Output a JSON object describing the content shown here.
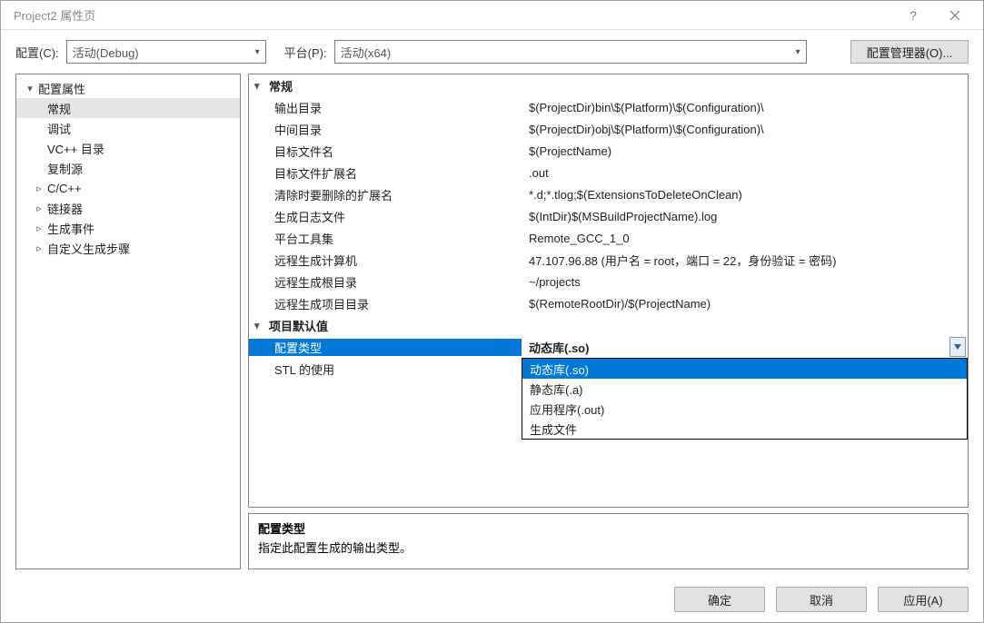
{
  "window": {
    "title": "Project2 属性页"
  },
  "toolbar": {
    "config_label": "配置(C):",
    "config_value": "活动(Debug)",
    "platform_label": "平台(P):",
    "platform_value": "活动(x64)",
    "config_mgr": "配置管理器(O)..."
  },
  "tree": {
    "root": "配置属性",
    "items": [
      {
        "label": "常规",
        "selected": true
      },
      {
        "label": "调试"
      },
      {
        "label": "VC++ 目录"
      },
      {
        "label": "复制源"
      },
      {
        "label": "C/C++",
        "expandable": true
      },
      {
        "label": "链接器",
        "expandable": true
      },
      {
        "label": "生成事件",
        "expandable": true
      },
      {
        "label": "自定义生成步骤",
        "expandable": true
      }
    ]
  },
  "categories": [
    {
      "name": "常规",
      "props": [
        {
          "name": "输出目录",
          "value": "$(ProjectDir)bin\\$(Platform)\\$(Configuration)\\"
        },
        {
          "name": "中间目录",
          "value": "$(ProjectDir)obj\\$(Platform)\\$(Configuration)\\"
        },
        {
          "name": "目标文件名",
          "value": "$(ProjectName)"
        },
        {
          "name": "目标文件扩展名",
          "value": ".out"
        },
        {
          "name": "清除时要删除的扩展名",
          "value": "*.d;*.tlog;$(ExtensionsToDeleteOnClean)"
        },
        {
          "name": "生成日志文件",
          "value": "$(IntDir)$(MSBuildProjectName).log"
        },
        {
          "name": "平台工具集",
          "value": "Remote_GCC_1_0"
        },
        {
          "name": "远程生成计算机",
          "value": "47.107.96.88 (用户名 = root，端口 = 22，身份验证 = 密码)"
        },
        {
          "name": "远程生成根目录",
          "value": "~/projects"
        },
        {
          "name": "远程生成项目目录",
          "value": "$(RemoteRootDir)/$(ProjectName)"
        }
      ]
    },
    {
      "name": "项目默认值",
      "props": [
        {
          "name": "配置类型",
          "value": "动态库(.so)",
          "selected": true
        },
        {
          "name": "STL 的使用",
          "value": ""
        }
      ]
    }
  ],
  "dropdown": {
    "options": [
      {
        "label": "动态库(.so)",
        "highlighted": true
      },
      {
        "label": "静态库(.a)"
      },
      {
        "label": "应用程序(.out)"
      },
      {
        "label": "生成文件"
      }
    ]
  },
  "desc": {
    "title": "配置类型",
    "text": "指定此配置生成的输出类型。"
  },
  "footer": {
    "ok": "确定",
    "cancel": "取消",
    "apply": "应用(A)"
  }
}
